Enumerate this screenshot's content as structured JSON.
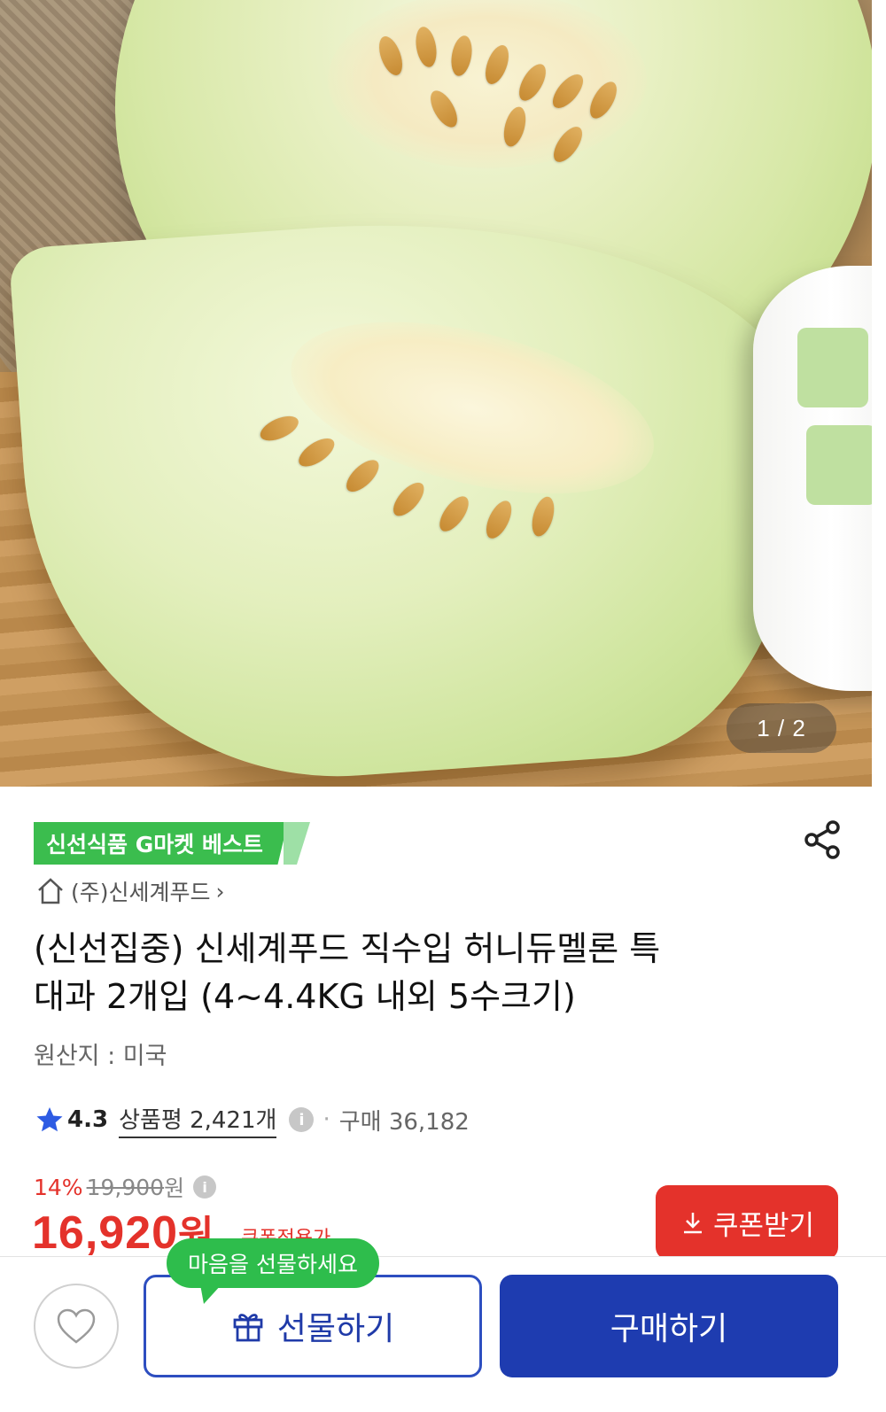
{
  "hero": {
    "counter": "1 / 2"
  },
  "product": {
    "badge": "신선식품 G마켓 베스트",
    "seller": "(주)신세계푸드",
    "seller_chevron": "›",
    "title_line1": "(신선집중) 신세계푸드 직수입 허니듀멜론 특",
    "title_line2": "대과 2개입 (4~4.4KG 내외 5수크기)",
    "origin": "원산지 : 미국"
  },
  "rating": {
    "score": "4.3",
    "reviews": "상품평 2,421개",
    "info": "i",
    "separator": "·",
    "purchase": "구매 36,182"
  },
  "price": {
    "discount": "14%",
    "original": "19,900",
    "original_unit": "원",
    "info": "i",
    "current": "16,920",
    "current_unit": "원",
    "coupon_note": "쿠폰적용가",
    "coupon_button": "쿠폰받기"
  },
  "bottom_bar": {
    "tooltip": "마음을 선물하세요",
    "gift_button": "선물하기",
    "buy_button": "구매하기"
  },
  "colors": {
    "accent_blue": "#1e3cb0",
    "sale_red": "#e4322b",
    "badge_green": "#3bbd4e"
  }
}
